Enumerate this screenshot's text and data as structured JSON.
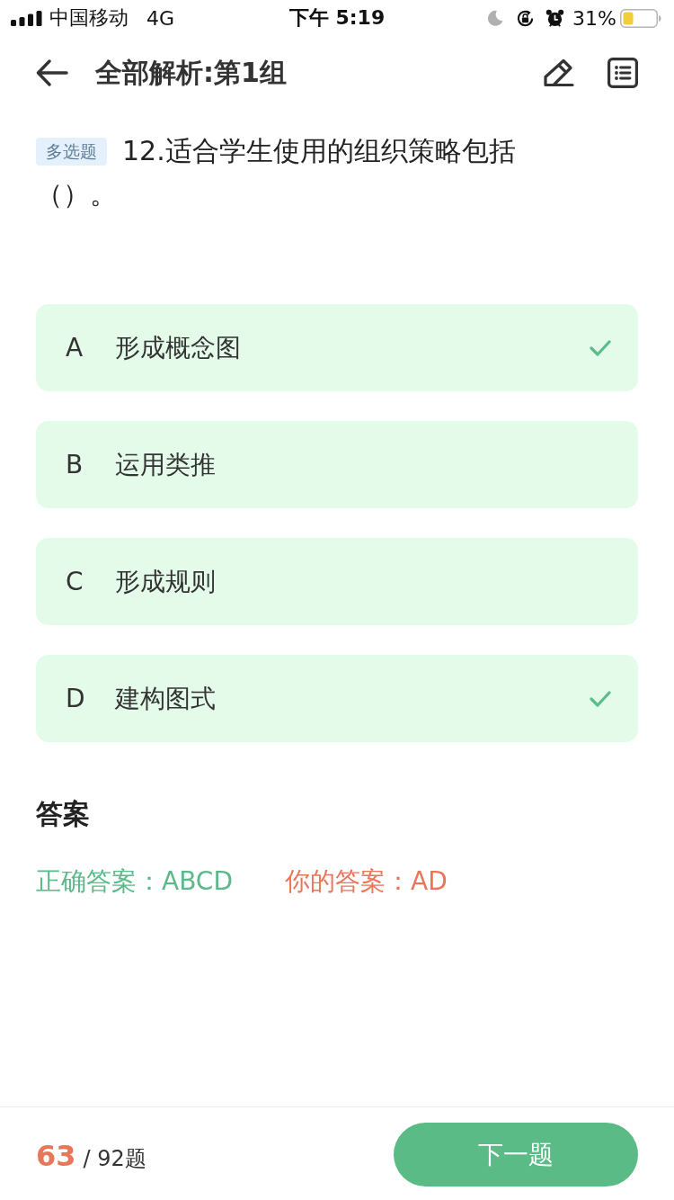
{
  "status_bar": {
    "carrier": "中国移动",
    "network": "4G",
    "time": "下午 5:19",
    "battery": "31%"
  },
  "nav": {
    "title": "全部解析:第1组"
  },
  "question": {
    "type_tag": "多选题",
    "lines": [
      "12.适合学生使用的组织策略包括",
      "（）。"
    ]
  },
  "options": [
    {
      "letter": "A",
      "text": "形成概念图",
      "selected": true
    },
    {
      "letter": "B",
      "text": "运用类推",
      "selected": false
    },
    {
      "letter": "C",
      "text": "形成规则",
      "selected": false
    },
    {
      "letter": "D",
      "text": "建构图式",
      "selected": true
    }
  ],
  "answer": {
    "heading": "答案",
    "correct": "正确答案：ABCD",
    "yours": "你的答案：AD"
  },
  "footer": {
    "current": "63",
    "total": "/ 92题",
    "next_button": "下一题"
  }
}
